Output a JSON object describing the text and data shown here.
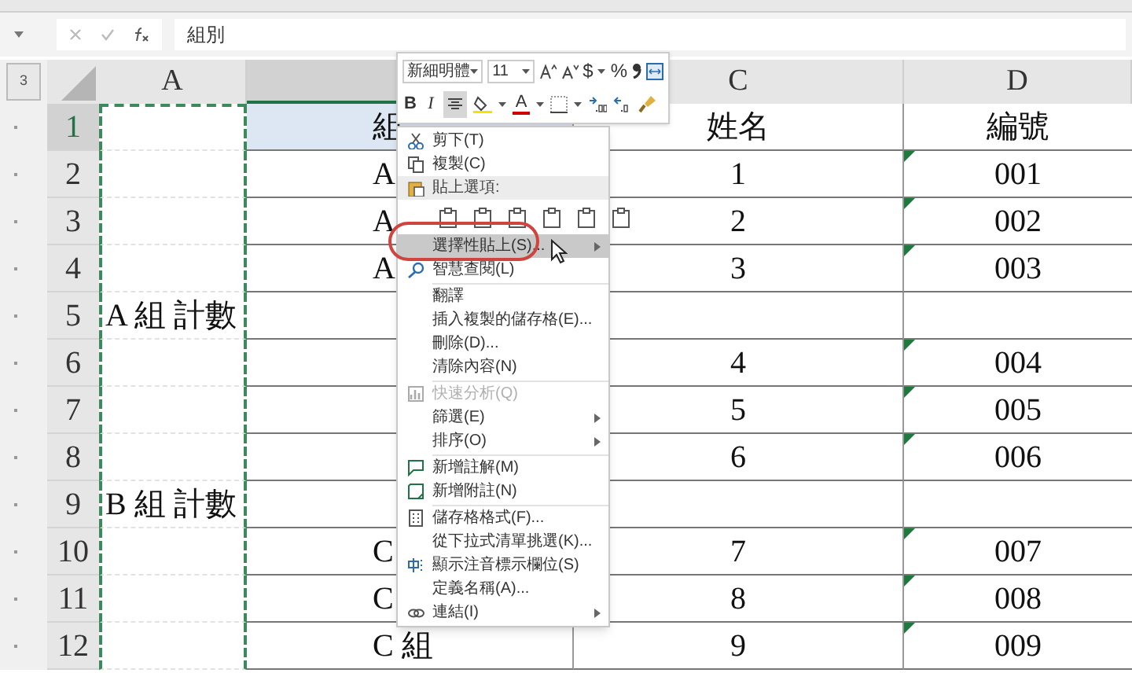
{
  "formula_bar": {
    "value": "組別"
  },
  "outline": {
    "level_button": "3"
  },
  "columns": [
    {
      "label": "A",
      "selected": false
    },
    {
      "selected": true
    },
    {
      "label": "C",
      "selected": false
    },
    {
      "label": "D",
      "selected": false
    }
  ],
  "rows": [
    {
      "number": "1",
      "selected": true,
      "b": "組",
      "c": "姓名",
      "d": "編號",
      "d_flag": false
    },
    {
      "number": "2",
      "selected": false,
      "b": "A",
      "c": "1",
      "d": "001",
      "d_flag": true
    },
    {
      "number": "3",
      "selected": false,
      "b": "A",
      "c": "2",
      "d": "002",
      "d_flag": true
    },
    {
      "number": "4",
      "selected": false,
      "b": "A",
      "c": "3",
      "d": "003",
      "d_flag": true
    },
    {
      "number": "5",
      "selected": false,
      "a": "A 組 計數",
      "d_flag": false
    },
    {
      "number": "6",
      "selected": false,
      "c": "4",
      "d": "004",
      "d_flag": true
    },
    {
      "number": "7",
      "selected": false,
      "c": "5",
      "d": "005",
      "d_flag": true
    },
    {
      "number": "8",
      "selected": false,
      "c": "6",
      "d": "006",
      "d_flag": true
    },
    {
      "number": "9",
      "selected": false,
      "a": "B 組 計數",
      "d_flag": false
    },
    {
      "number": "10",
      "selected": false,
      "b": "C",
      "c": "7",
      "d": "007",
      "d_flag": true
    },
    {
      "number": "11",
      "selected": false,
      "b": "C",
      "c": "8",
      "d": "008",
      "d_flag": true
    },
    {
      "number": "12",
      "selected": false,
      "b": "C 組",
      "c": "9",
      "d": "009",
      "d_flag": true
    }
  ],
  "mini_toolbar": {
    "font": "新細明體",
    "size": "11",
    "currency": "$",
    "percent": "%",
    "bold": "B",
    "italic": "I",
    "font_color": "A",
    "align_center_selected": true
  },
  "context_menu": {
    "items": [
      {
        "kind": "item",
        "label": "剪下(T)",
        "selected": false,
        "disabled": false,
        "submenu": false
      },
      {
        "kind": "item",
        "label": "複製(C)",
        "selected": false,
        "disabled": false,
        "submenu": false
      },
      {
        "kind": "header",
        "label": "貼上選項:"
      },
      {
        "kind": "paste_icons"
      },
      {
        "kind": "item",
        "label": "選擇性貼上(S)...",
        "selected": true,
        "disabled": false,
        "submenu": true
      },
      {
        "kind": "item",
        "label": "智慧查閱(L)",
        "selected": false,
        "disabled": false,
        "submenu": false
      },
      {
        "kind": "separator"
      },
      {
        "kind": "item",
        "label": "翻譯",
        "selected": false,
        "disabled": false,
        "submenu": false
      },
      {
        "kind": "item",
        "label": "插入複製的儲存格(E)...",
        "selected": false,
        "disabled": false,
        "submenu": false
      },
      {
        "kind": "item",
        "label": "刪除(D)...",
        "selected": false,
        "disabled": false,
        "submenu": false
      },
      {
        "kind": "item",
        "label": "清除內容(N)",
        "selected": false,
        "disabled": false,
        "submenu": false
      },
      {
        "kind": "separator"
      },
      {
        "kind": "item",
        "label": "快速分析(Q)",
        "selected": false,
        "disabled": true,
        "submenu": false
      },
      {
        "kind": "item",
        "label": "篩選(E)",
        "selected": false,
        "disabled": false,
        "submenu": true
      },
      {
        "kind": "item",
        "label": "排序(O)",
        "selected": false,
        "disabled": false,
        "submenu": true
      },
      {
        "kind": "separator"
      },
      {
        "kind": "item",
        "label": "新增註解(M)",
        "selected": false,
        "disabled": false,
        "submenu": false
      },
      {
        "kind": "item",
        "label": "新增附註(N)",
        "selected": false,
        "disabled": false,
        "submenu": false
      },
      {
        "kind": "separator"
      },
      {
        "kind": "item",
        "label": "儲存格格式(F)...",
        "selected": false,
        "disabled": false,
        "submenu": false
      },
      {
        "kind": "item",
        "label": "從下拉式清單挑選(K)...",
        "selected": false,
        "disabled": false,
        "submenu": false
      },
      {
        "kind": "item",
        "label": "顯示注音標示欄位(S)",
        "selected": false,
        "disabled": false,
        "submenu": false
      },
      {
        "kind": "item",
        "label": "定義名稱(A)...",
        "selected": false,
        "disabled": false,
        "submenu": false
      },
      {
        "kind": "item",
        "label": "連結(I)",
        "selected": false,
        "disabled": false,
        "submenu": true
      }
    ]
  }
}
